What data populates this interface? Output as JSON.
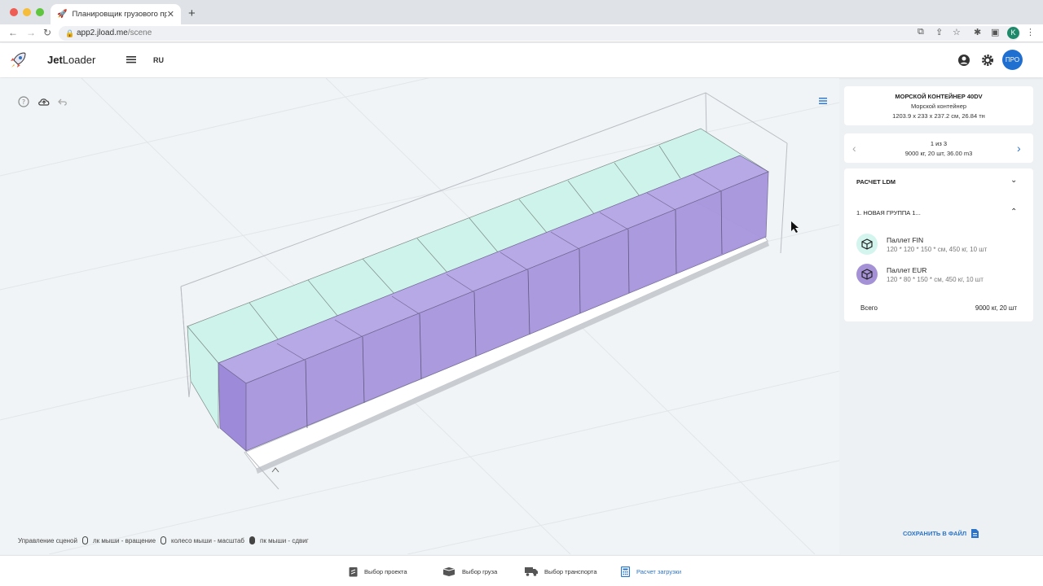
{
  "browser": {
    "tab_title": "Планировщик грузового про",
    "url_host": "app2.jload.me",
    "url_path": "/scene",
    "profile_initial": "K"
  },
  "app": {
    "brand_bold": "Jet",
    "brand_rest": "Loader",
    "lang": "RU",
    "pro_label": "ПРО",
    "accent": "#2a74c9"
  },
  "scene": {
    "controls_label": "Управление сценой",
    "control_rotate": "лк мыши - вращение",
    "control_zoom": "колесо мыши - масштаб",
    "control_pan": "пк мыши - сдвиг",
    "cargo_colors": {
      "fin": "#c8f2ea",
      "eur": "#9b86d9"
    }
  },
  "container": {
    "title": "МОРСКОЙ КОНТЕЙНЕР 40DV",
    "subtitle": "Морской контейнер",
    "dims": "1203.9 x 233 x 237.2 см, 26.84 тн"
  },
  "pager": {
    "position": "1 из 3",
    "summary": "9000 кг, 20 шт, 36.00 m3"
  },
  "ldm": {
    "title": "РАСЧЕТ LDM"
  },
  "group": {
    "title": "1. НОВАЯ ГРУППА 1...",
    "items": [
      {
        "name": "Паллет FIN",
        "dims": "120 * 120 * 150 * см, 450 кг, 10 шт",
        "color": "#d3f5ee"
      },
      {
        "name": "Паллет EUR",
        "dims": "120 * 80 * 150 * см, 450 кг, 10 шт",
        "color": "#a592d6"
      }
    ],
    "total_label": "Всего",
    "total_value": "9000 кг, 20 шт"
  },
  "save_label": "СОХРАНИТЬ В ФАЙЛ",
  "bottom_nav": [
    {
      "label": "Выбор проекта"
    },
    {
      "label": "Выбор груза"
    },
    {
      "label": "Выбор транспорта"
    },
    {
      "label": "Расчет загрузки"
    }
  ]
}
